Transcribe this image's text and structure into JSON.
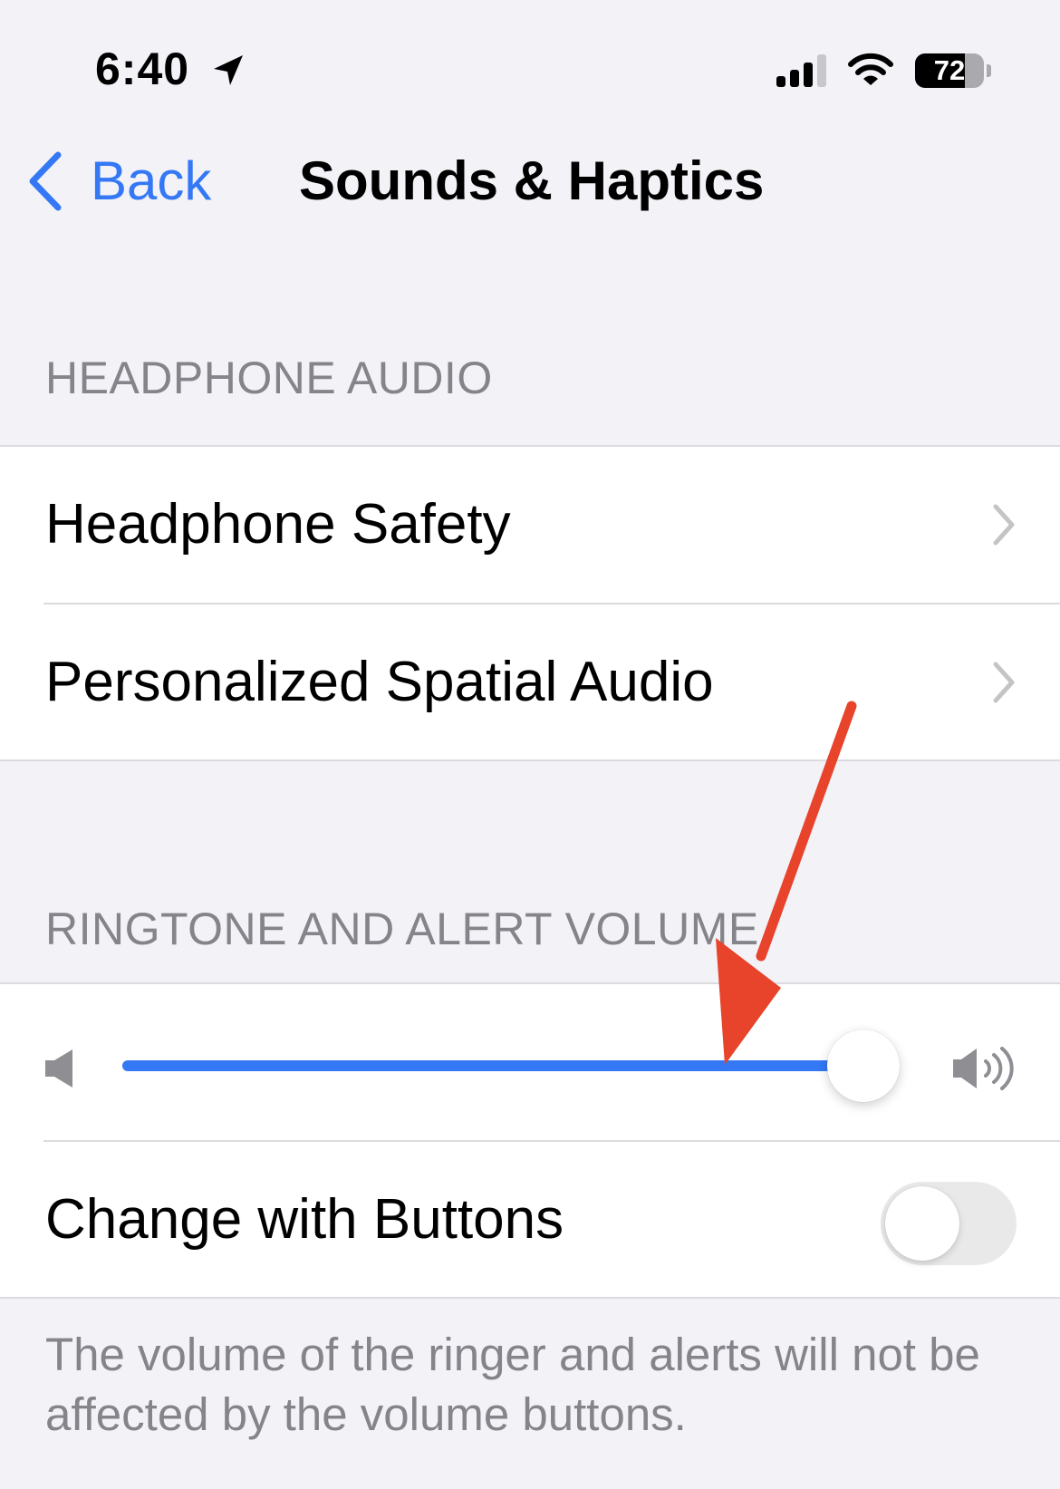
{
  "status_bar": {
    "time": "6:40",
    "battery_level": "72",
    "battery_fraction": 0.72
  },
  "nav": {
    "back_label": "Back",
    "title": "Sounds & Haptics"
  },
  "headphone_audio": {
    "header": "HEADPHONE AUDIO",
    "items": [
      {
        "label": "Headphone Safety"
      },
      {
        "label": "Personalized Spatial Audio"
      }
    ]
  },
  "ringtone": {
    "header": "RINGTONE AND ALERT VOLUME",
    "volume_fraction": 0.98,
    "change_with_buttons": {
      "label": "Change with Buttons",
      "enabled": false
    },
    "footer": "The volume of the ringer and alerts will not be affected by the volume buttons."
  },
  "annotation": {
    "arrow_color": "#e8432b"
  },
  "colors": {
    "accent": "#3478f6",
    "background": "#f2f2f7",
    "secondary_text": "#84848a"
  },
  "icons": [
    "location-arrow-icon",
    "cellular-signal-icon",
    "wifi-icon",
    "battery-icon",
    "back-chevron-icon",
    "chevron-right-icon",
    "speaker-low-icon",
    "speaker-high-icon"
  ]
}
